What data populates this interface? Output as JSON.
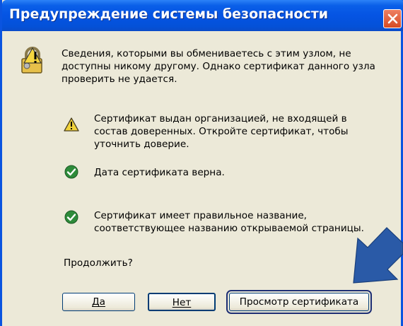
{
  "dialog": {
    "title": "Предупреждение системы безопасности",
    "intro": [
      "Сведения, которыми вы обмениваетесь с этим узлом, не",
      "доступны никому другому. Однако сертификат данного узла",
      "проверить не удается."
    ],
    "items": [
      {
        "icon": "warning-icon",
        "lines": [
          "Сертификат выдан организацией, не входящей в",
          "состав доверенных. Откройте сертификат, чтобы",
          "уточнить доверие."
        ]
      },
      {
        "icon": "check-icon",
        "lines": [
          "Дата сертификата верна."
        ]
      },
      {
        "icon": "check-icon",
        "lines": [
          "Сертификат имеет правильное название,",
          "соответствующее названию открываемой страницы."
        ]
      }
    ],
    "question": "Продолжить?",
    "buttons": {
      "yes": "Да",
      "no": "Нет",
      "view": "Просмотр сертификата"
    }
  },
  "colors": {
    "titlebar": "#0554e3",
    "window_bg": "#ece9d8",
    "arrow": "#2a5aa7",
    "check": "#2e8b3a",
    "warning": "#f0d23a"
  }
}
